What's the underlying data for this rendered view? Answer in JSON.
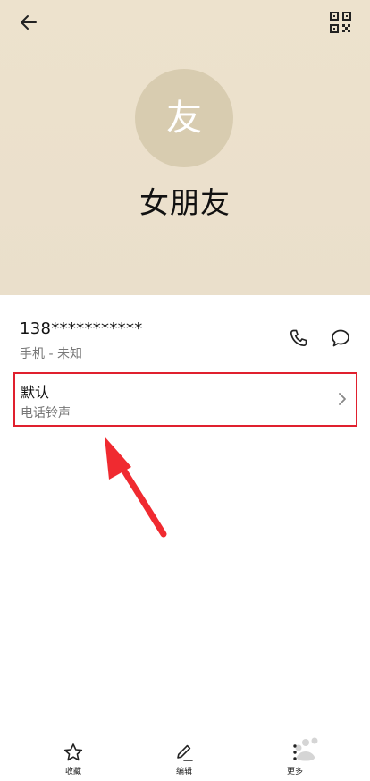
{
  "contact": {
    "avatar_char": "友",
    "name": "女朋友"
  },
  "phone": {
    "number": "138***********",
    "type": "手机 - 未知"
  },
  "ringtone": {
    "value": "默认",
    "label": "电话铃声"
  },
  "bottom_bar": {
    "favorite": "收藏",
    "edit": "编辑",
    "more": "更多"
  },
  "colors": {
    "header_bg": "#ece1cc",
    "avatar_bg": "#d8ccb0",
    "highlight_border": "#e0202e",
    "arrow": "#f02a30"
  },
  "icons": [
    "back-arrow-icon",
    "qr-code-icon",
    "phone-icon",
    "message-icon",
    "chevron-right-icon",
    "star-icon",
    "pencil-icon",
    "more-dots-icon"
  ]
}
